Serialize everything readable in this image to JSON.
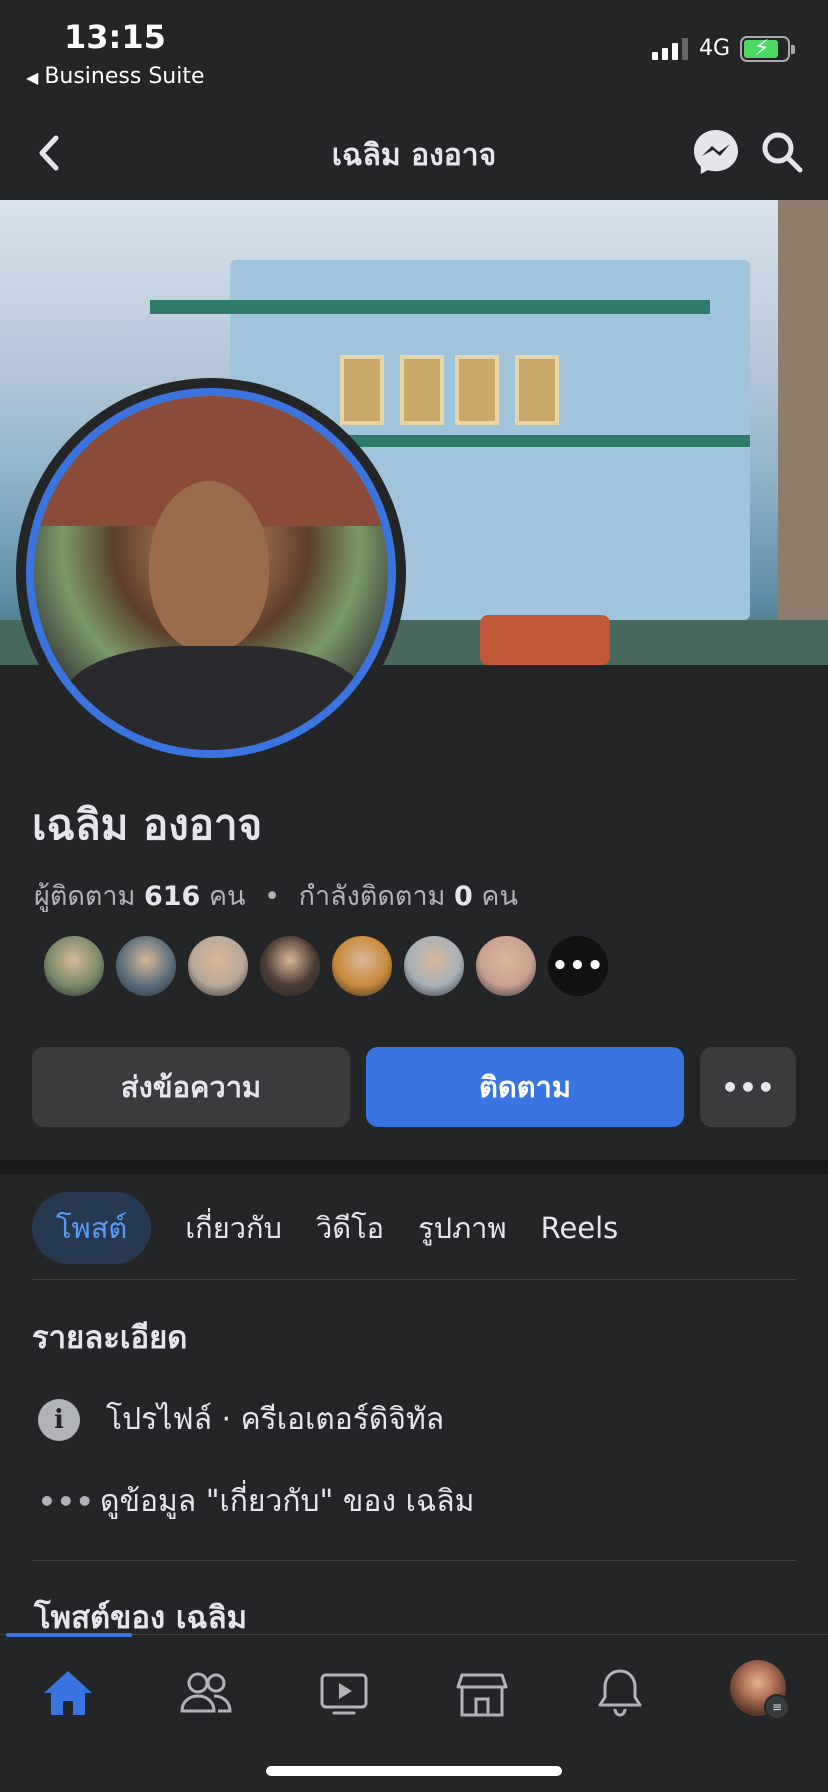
{
  "status_bar": {
    "time": "13:15",
    "back_app": "Business Suite",
    "network": "4G"
  },
  "nav": {
    "title": "เฉลิม องอาจ"
  },
  "profile": {
    "name": "เฉลิม องอาจ",
    "followers_label": "ผู้ติดตาม",
    "followers_count": "616",
    "people_unit": "คน",
    "separator": "•",
    "following_label": "กำลังติดตาม",
    "following_count": "0",
    "follower_avatars": [
      {
        "color": "#7a8a6a"
      },
      {
        "color": "#5a6e7c"
      },
      {
        "color": "#b8a898"
      },
      {
        "color": "#4a3a32"
      },
      {
        "color": "#c98a3a"
      },
      {
        "color": "#a8b0b8"
      },
      {
        "color": "#c8a090"
      },
      {
        "more": "•••"
      }
    ]
  },
  "actions": {
    "message": "ส่งข้อความ",
    "follow": "ติดตาม",
    "more": "•••"
  },
  "tabs": [
    {
      "label": "โพสต์",
      "active": true
    },
    {
      "label": "เกี่ยวกับ"
    },
    {
      "label": "วิดีโอ"
    },
    {
      "label": "รูปภาพ"
    },
    {
      "label": "Reels"
    }
  ],
  "details": {
    "title": "รายละเอียด",
    "profile_type": "โปรไฟล์ · ครีเอเตอร์ดิจิทัล",
    "about_link": "ดูข้อมูล \"เกี่ยวกับ\" ของ เฉลิม"
  },
  "posts": {
    "title": "โพสต์ของ เฉลิม"
  },
  "tab_bar": {
    "items": [
      "home-icon",
      "friends-icon",
      "video-icon",
      "marketplace-icon",
      "notifications-icon",
      "profile-menu"
    ]
  },
  "colors": {
    "accent": "#3a74e0",
    "background": "#242526",
    "button_secondary": "#3a3b3c"
  }
}
